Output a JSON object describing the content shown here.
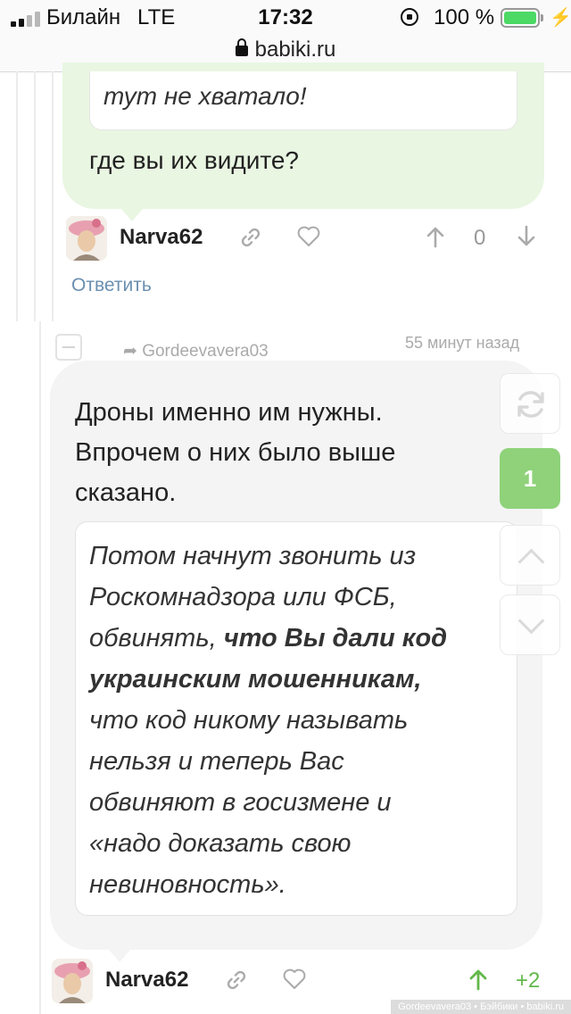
{
  "status_bar": {
    "carrier": "Билайн",
    "network": "LTE",
    "time": "17:32",
    "battery_pct": "100 %",
    "battery_color": "#4cd964"
  },
  "url_bar": {
    "domain": "babiki.ru"
  },
  "comment1": {
    "quote_tail": "тут не хватало!",
    "text": "где вы их видите?",
    "author": "Narva62",
    "score": "0",
    "reply_label": "Ответить",
    "icons": [
      "link-icon",
      "heart-icon",
      "upvote-icon",
      "downvote-icon"
    ]
  },
  "comment2": {
    "reply_to": "Gordeevavera03",
    "time_ago": "55 минут назад",
    "text": "Дроны именно им нужны. Впрочем о них было выше сказано.",
    "quote_lines": [
      "Потом начнут звонить из",
      "Роскомнадзора или ФСБ,",
      "обвинять, что Вы дали код",
      "украинским мошенникам,",
      "что код никому называть",
      "нельзя и теперь Вас",
      "обвиняют в госизмене и",
      "«надо доказать свою",
      "невиновность»."
    ],
    "quote_bold_prefix": "обвинять, ",
    "quote_bold_part": "что Вы дали код",
    "author": "Narva62",
    "score": "+2",
    "score_color": "#62b84a"
  },
  "side_panel": {
    "new_count": "1"
  },
  "watermark": "Gordeevavera03 • Бэйбики • babiki.ru"
}
